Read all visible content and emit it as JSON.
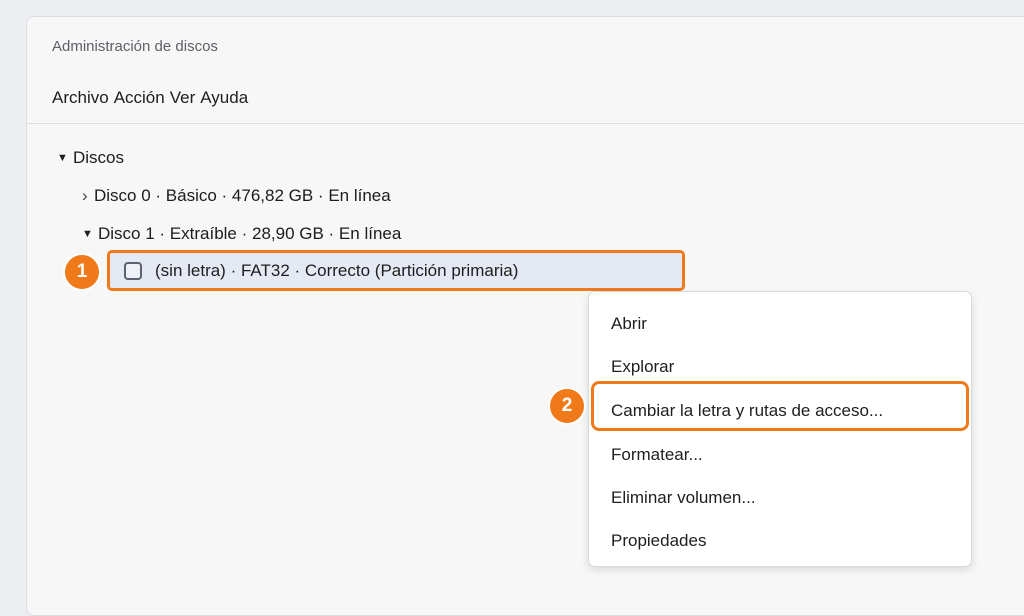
{
  "window": {
    "title": "Administración de discos"
  },
  "menubar": {
    "items": [
      "Archivo",
      "Acción",
      "Ver",
      "Ayuda"
    ]
  },
  "tree": {
    "root": "Discos",
    "disk0": "Disco 0 · Básico · 476,82 GB · En línea",
    "disk1": "Disco 1 · Extraíble · 28,90 GB · En línea",
    "volume": "(sin letra) · FAT32 · Correcto (Partición primaria)"
  },
  "context_menu": {
    "items": [
      "Abrir",
      "Explorar",
      "Cambiar la letra y rutas de acceso...",
      "Formatear...",
      "Eliminar volumen...",
      "Propiedades"
    ]
  },
  "badges": {
    "step1": "1",
    "step2": "2"
  },
  "colors": {
    "accent": "#f07a19",
    "selection": "#e5e9f4"
  }
}
